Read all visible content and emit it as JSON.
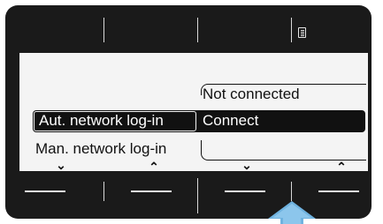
{
  "options": {
    "selected": "Aut. network log-in",
    "other": "Man. network log-in"
  },
  "status": {
    "value": "Not connected",
    "action": "Connect"
  },
  "softkeys": [
    {
      "icon": "chevron-down-icon",
      "glyph": "⌄"
    },
    {
      "icon": "chevron-up-icon",
      "glyph": "⌃"
    },
    {
      "icon": "chevron-down-icon",
      "glyph": "⌄"
    },
    {
      "icon": "chevron-up-icon",
      "glyph": "⌃"
    }
  ],
  "colors": {
    "bezel": "#1a1a1a",
    "screen": "#f4f4f4",
    "highlight": "#111111",
    "pointer": "#6fb3e0"
  }
}
